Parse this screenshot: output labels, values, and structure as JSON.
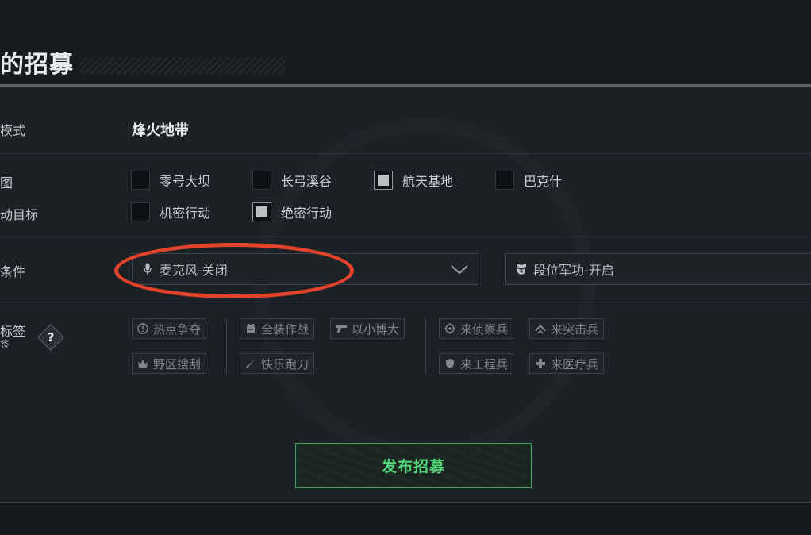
{
  "title": "的招募",
  "rows": {
    "mode_label": "模式",
    "mode_value": "烽火地带",
    "map_label": "图",
    "target_label": "动目标",
    "condition_label": "条件",
    "tags_label": "标签",
    "tags_label_line2": "签"
  },
  "maps": [
    {
      "label": "零号大坝",
      "checked": false
    },
    {
      "label": "长弓溪谷",
      "checked": false
    },
    {
      "label": "航天基地",
      "checked": true
    },
    {
      "label": "巴克什",
      "checked": false
    }
  ],
  "targets": [
    {
      "label": "机密行动",
      "checked": false
    },
    {
      "label": "绝密行动",
      "checked": true
    }
  ],
  "conditions": {
    "microphone": {
      "value": "麦克风-关闭",
      "icon": "microphone-icon"
    },
    "rank": {
      "value": "段位军功-开启",
      "icon": "rank-badge-icon"
    }
  },
  "tags": {
    "group1": [
      {
        "label": "热点争夺",
        "icon": "alert-circle-icon"
      },
      {
        "label": "野区搜刮",
        "icon": "crown-icon"
      }
    ],
    "group2": [
      {
        "label": "全装作战",
        "icon": "armor-icon"
      },
      {
        "label": "以小博大",
        "icon": "pistol-icon"
      },
      {
        "label": "快乐跑刀",
        "icon": "knife-icon"
      }
    ],
    "group3": [
      {
        "label": "来侦察兵",
        "icon": "crosshair-icon"
      },
      {
        "label": "来突击兵",
        "icon": "chevron-rank-icon"
      },
      {
        "label": "来工程兵",
        "icon": "shield-icon"
      },
      {
        "label": "来医疗兵",
        "icon": "medical-cross-icon"
      }
    ]
  },
  "help_symbol": "?",
  "publish_button": "发布招募",
  "colors": {
    "accent_green": "#52d67a",
    "annotation_red": "#e2432a"
  }
}
